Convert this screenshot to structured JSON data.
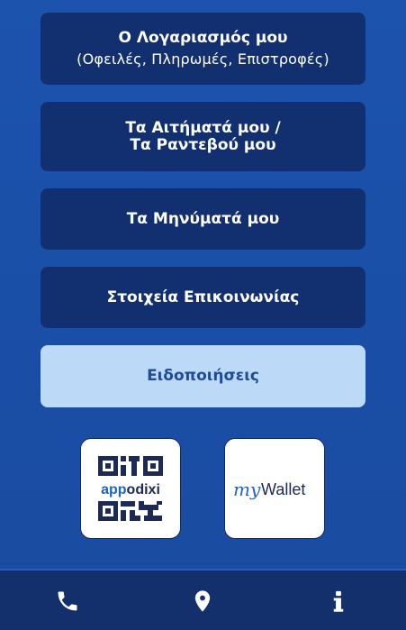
{
  "menu": {
    "account_title": "Ο Λογαριασμός μου",
    "account_sub": "(Οφειλές, Πληρωμές, Επιστροφές)",
    "requests_line1": "Τα Αιτήματά μου /",
    "requests_line2": "Τα Ραντεβού μου",
    "messages": "Τα Μηνύματά μου",
    "contact": "Στοιχεία Επικοινωνίας",
    "notifications": "Ειδοποιήσεις"
  },
  "apps": {
    "appodixi_prefix": "app",
    "appodixi_suffix": "odixi",
    "mywallet_my": "my",
    "mywallet_wallet": "Wallet"
  },
  "icons": {
    "nav": [
      "phone-icon",
      "location-pin-icon",
      "info-icon"
    ]
  },
  "colors": {
    "background": "#1c53ad",
    "button_dark": "#12306f",
    "button_light": "#bcd9f7",
    "accent_text": "#1d4c9b",
    "bottom_bar": "#13306c"
  }
}
